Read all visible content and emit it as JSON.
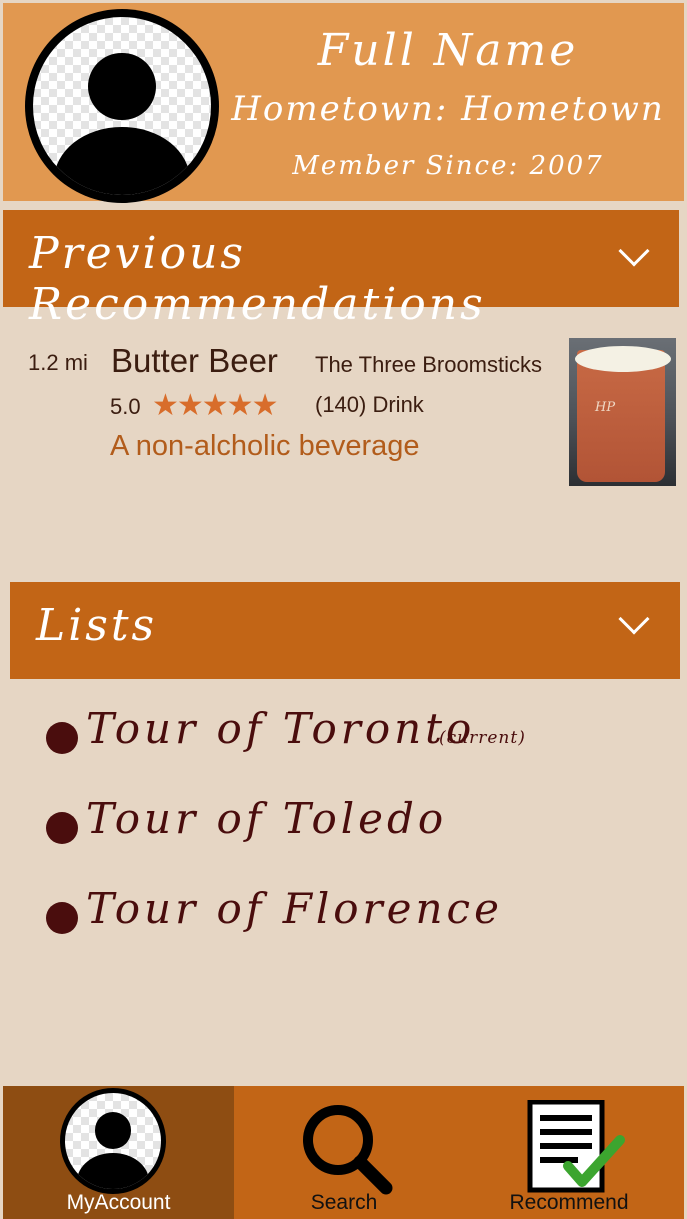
{
  "profile": {
    "full_name": "Full Name",
    "hometown": "Hometown: Hometown",
    "member_since": "Member Since: 2007"
  },
  "previous_recommendations": {
    "title": "Previous Recommendations",
    "items": [
      {
        "distance": "1.2 mi",
        "name": "Butter Beer",
        "place": "The Three Broomsticks",
        "rating": "5.0",
        "stars": "★★★★★",
        "reviews_category": "(140) Drink",
        "description": "A non-alcholic beverage"
      }
    ]
  },
  "lists": {
    "title": "Lists",
    "items": [
      {
        "label": "Tour of Toronto",
        "note": "(current)"
      },
      {
        "label": "Tour of Toledo",
        "note": ""
      },
      {
        "label": "Tour of Florence",
        "note": ""
      }
    ]
  },
  "nav": {
    "myaccount": "MyAccount",
    "search": "Search",
    "recommend": "Recommend"
  },
  "colors": {
    "header": "#e19850",
    "section_bar": "#c26516",
    "background": "#e6d6c4",
    "nav_active": "#8e4d12",
    "star": "#d86d2b",
    "list_text": "#4a0d0d"
  }
}
